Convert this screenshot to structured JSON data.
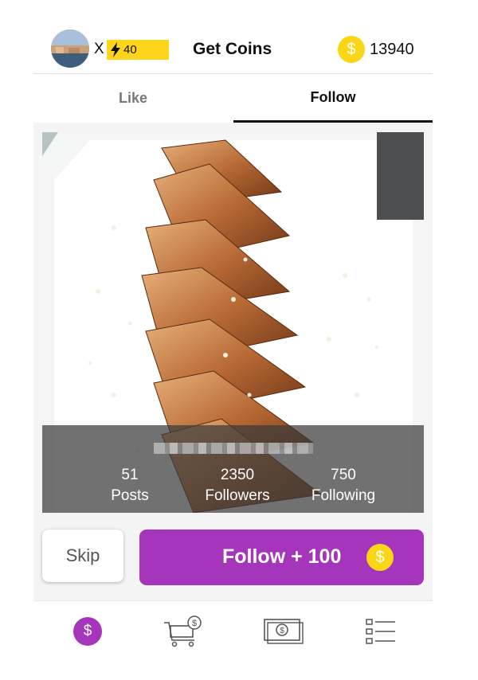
{
  "header": {
    "multiplier": "X",
    "energy": "40",
    "title": "Get Coins",
    "coins": "13940",
    "coin_symbol": "$"
  },
  "tabs": [
    {
      "label": "Like",
      "active": false
    },
    {
      "label": "Follow",
      "active": true
    }
  ],
  "profile": {
    "stats": [
      {
        "value": "51",
        "label": "Posts"
      },
      {
        "value": "2350",
        "label": "Followers"
      },
      {
        "value": "750",
        "label": "Following"
      }
    ]
  },
  "actions": {
    "skip_label": "Skip",
    "follow_label": "Follow + 100",
    "coin_symbol": "$"
  },
  "bottom_nav": {
    "items": [
      {
        "icon": "coin-icon",
        "symbol": "$",
        "active": true
      },
      {
        "icon": "shop-cart-icon",
        "active": false
      },
      {
        "icon": "banknote-icon",
        "active": false
      },
      {
        "icon": "list-icon",
        "active": false
      }
    ]
  },
  "colors": {
    "accent_purple": "#a535ba",
    "coin_yellow": "#fbd617",
    "energy_yellow": "#ffd51c"
  }
}
